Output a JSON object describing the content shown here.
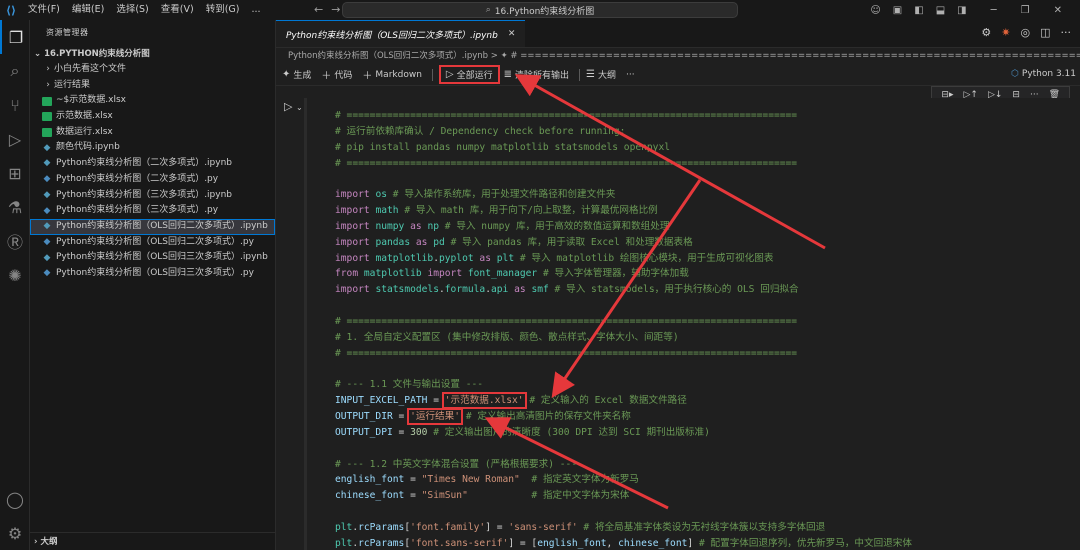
{
  "titlebar": {
    "menu": [
      "文件(F)",
      "编辑(E)",
      "选择(S)",
      "查看(V)",
      "转到(G)",
      "..."
    ],
    "search_text": "16.Python约束线分析图"
  },
  "sidebar": {
    "header": "资源管理器",
    "folder": "16.PYTHON约束线分析图",
    "items": [
      {
        "label": "小白先看这个文件",
        "type": "folder"
      },
      {
        "label": "运行结果",
        "type": "folder"
      },
      {
        "label": "~$示范数据.xlsx",
        "type": "xlsx"
      },
      {
        "label": "示范数据.xlsx",
        "type": "xlsx"
      },
      {
        "label": "数据运行.xlsx",
        "type": "xlsx"
      },
      {
        "label": "颜色代码.ipynb",
        "type": "ipynb"
      },
      {
        "label": "Python约束线分析图（二次多项式）.ipynb",
        "type": "ipynb"
      },
      {
        "label": "Python约束线分析图（二次多项式）.py",
        "type": "py"
      },
      {
        "label": "Python约束线分析图（三次多项式）.ipynb",
        "type": "ipynb"
      },
      {
        "label": "Python约束线分析图（三次多项式）.py",
        "type": "py"
      },
      {
        "label": "Python约束线分析图（OLS回归二次多项式）.ipynb",
        "type": "ipynb",
        "selected": true
      },
      {
        "label": "Python约束线分析图（OLS回归二次多项式）.py",
        "type": "py"
      },
      {
        "label": "Python约束线分析图（OLS回归三次多项式）.ipynb",
        "type": "ipynb"
      },
      {
        "label": "Python约束线分析图（OLS回归三次多项式）.py",
        "type": "py"
      }
    ],
    "outline": "大纲"
  },
  "editor": {
    "tab_label": "Python约束线分析图（OLS回归二次多项式）.ipynb",
    "breadcrumb": "Python约束线分析图（OLS回归二次多项式）.ipynb > ✦ # ===============================================================================",
    "toolbar": {
      "generate": "生成",
      "code": "代码",
      "markdown": "Markdown",
      "run_all": "全部运行",
      "clear_outputs": "清除所有输出",
      "outline": "大纲",
      "more": "···"
    },
    "kernel": "Python 3.11"
  },
  "code_lines": [
    "# ==============================================================================",
    "# 运行前依赖库确认 / Dependency check before running:",
    "# pip install pandas numpy matplotlib statsmodels openpyxl",
    "# ==============================================================================",
    "",
    "import os # 导入操作系统库，用于处理文件路径和创建文件夹",
    "import math # 导入 math 库，用于向下/向上取整，计算最优网格比例",
    "import numpy as np # 导入 numpy 库，用于高效的数值运算和数组处理",
    "import pandas as pd # 导入 pandas 库，用于读取 Excel 和处理数据表格",
    "import matplotlib.pyplot as plt # 导入 matplotlib 绘图核心模块，用于生成可视化图表",
    "from matplotlib import font_manager # 导入字体管理器，辅助字体加载",
    "import statsmodels.formula.api as smf # 导入 statsmodels，用于执行核心的 OLS 回归拟合",
    "",
    "# ==============================================================================",
    "# 1. 全局自定义配置区 (集中修改排版、颜色、散点样式、字体大小、间距等)",
    "# ==============================================================================",
    "",
    "# --- 1.1 文件与输出设置 ---",
    "INPUT_EXCEL_PATH = '示范数据.xlsx' # 定义输入的 Excel 数据文件路径",
    "OUTPUT_DIR = '运行结果' # 定义输出高清图片的保存文件夹名称",
    "OUTPUT_DPI = 300 # 定义输出图片的清晰度 (300 DPI 达到 SCI 期刊出版标准)",
    "",
    "# --- 1.2 中英文字体混合设置 (严格根据要求) ---",
    "english_font = \"Times New Roman\"  # 指定英文字体为新罗马",
    "chinese_font = \"SimSun\"           # 指定中文字体为宋体",
    "",
    "plt.rcParams['font.family'] = 'sans-serif' # 将全局基准字体类设为无衬线字体簇以支持多字体回退",
    "plt.rcParams['font.sans-serif'] = [english_font, chinese_font] # 配置字体回退序列，优先新罗马，中文回退宋体"
  ]
}
